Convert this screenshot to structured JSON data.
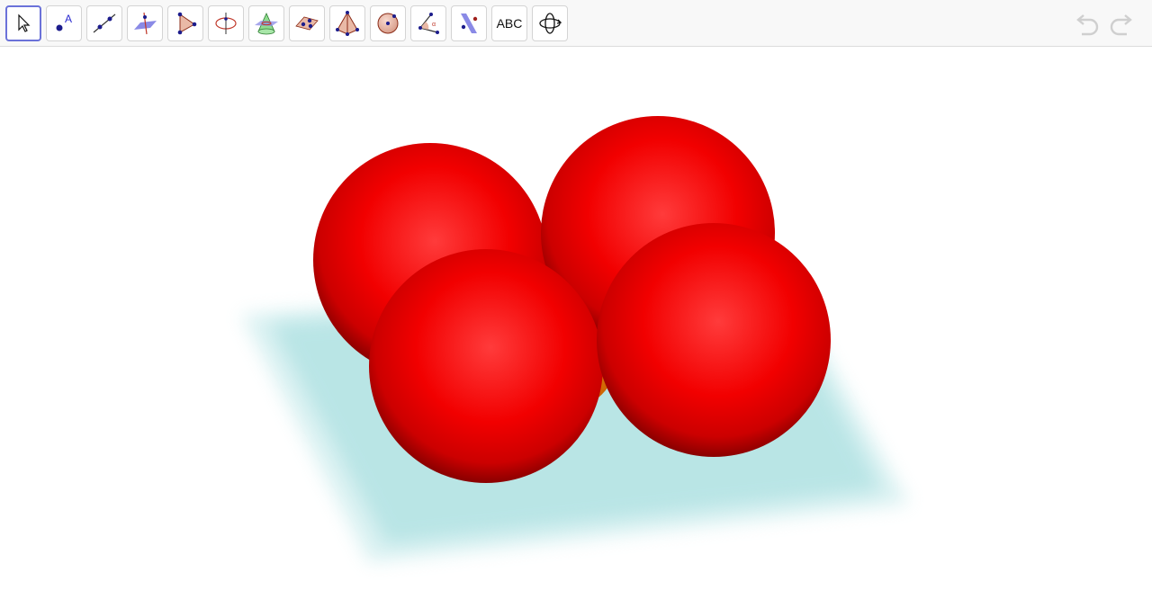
{
  "toolbar": {
    "tools": [
      {
        "id": "move",
        "icon": "move-arrow-icon",
        "active": true
      },
      {
        "id": "point",
        "icon": "point-icon",
        "label": "A"
      },
      {
        "id": "line",
        "icon": "line-through-two-points-icon"
      },
      {
        "id": "perpendicular",
        "icon": "perpendicular-line-icon"
      },
      {
        "id": "polygon",
        "icon": "polygon-icon"
      },
      {
        "id": "circle-axis",
        "icon": "circle-around-axis-icon"
      },
      {
        "id": "intersect-surfaces",
        "icon": "intersect-surfaces-icon"
      },
      {
        "id": "plane",
        "icon": "plane-through-points-icon"
      },
      {
        "id": "pyramid",
        "icon": "pyramid-icon"
      },
      {
        "id": "sphere",
        "icon": "sphere-icon"
      },
      {
        "id": "angle",
        "icon": "angle-icon"
      },
      {
        "id": "reflect",
        "icon": "reflect-about-plane-icon"
      },
      {
        "id": "text",
        "icon": "text-icon",
        "label": "ABC"
      },
      {
        "id": "rotate-view",
        "icon": "rotate-3d-view-icon"
      }
    ],
    "undo_icon": "undo-icon",
    "redo_icon": "redo-icon"
  },
  "scene": {
    "plane_color": "#aee1e2",
    "sphere_color": "#ff0000",
    "inner_sphere_color": "#ee7a00",
    "sphere_count": 4
  }
}
